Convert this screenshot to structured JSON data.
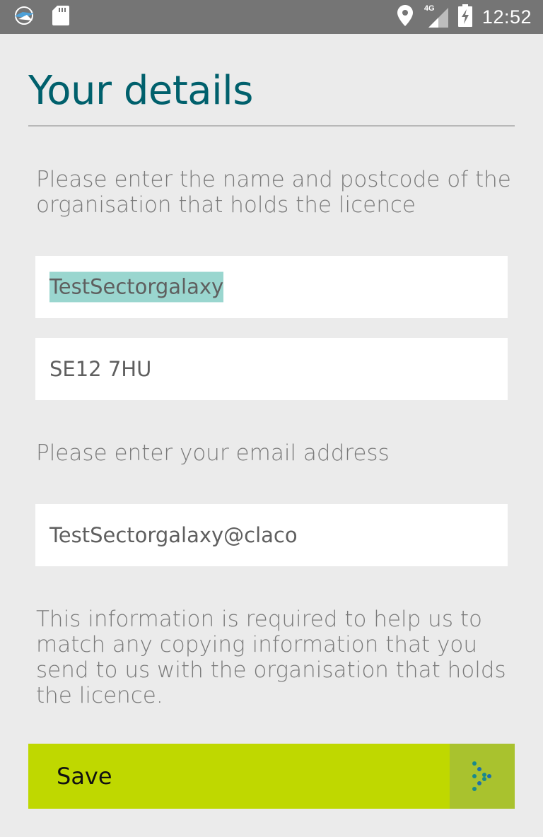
{
  "status_bar": {
    "time": "12:52",
    "network_label": "4G",
    "icons": [
      "app-logo-icon",
      "sd-card-icon",
      "location-icon",
      "signal-icon",
      "battery-charging-icon"
    ]
  },
  "page": {
    "title": "Your details"
  },
  "organisation": {
    "instruction": "Please enter the name and postcode of the organisation that holds the licence",
    "name_value": "TestSectorgalaxy",
    "postcode_value": "SE12 7HU"
  },
  "email": {
    "instruction": "Please enter your email address",
    "value": "TestSectorgalaxy@claco"
  },
  "info_text": "This information is required to help us to match any copying information that you send to us with the organisation that holds the licence.",
  "save": {
    "label": "Save",
    "icon": "dotted-arrow-icon"
  },
  "colors": {
    "title": "#00606c",
    "save_button": "#bfd800",
    "save_arrow_area": "#a9c22e",
    "selection_highlight": "#9ad6cf",
    "status_bar": "#757575"
  }
}
